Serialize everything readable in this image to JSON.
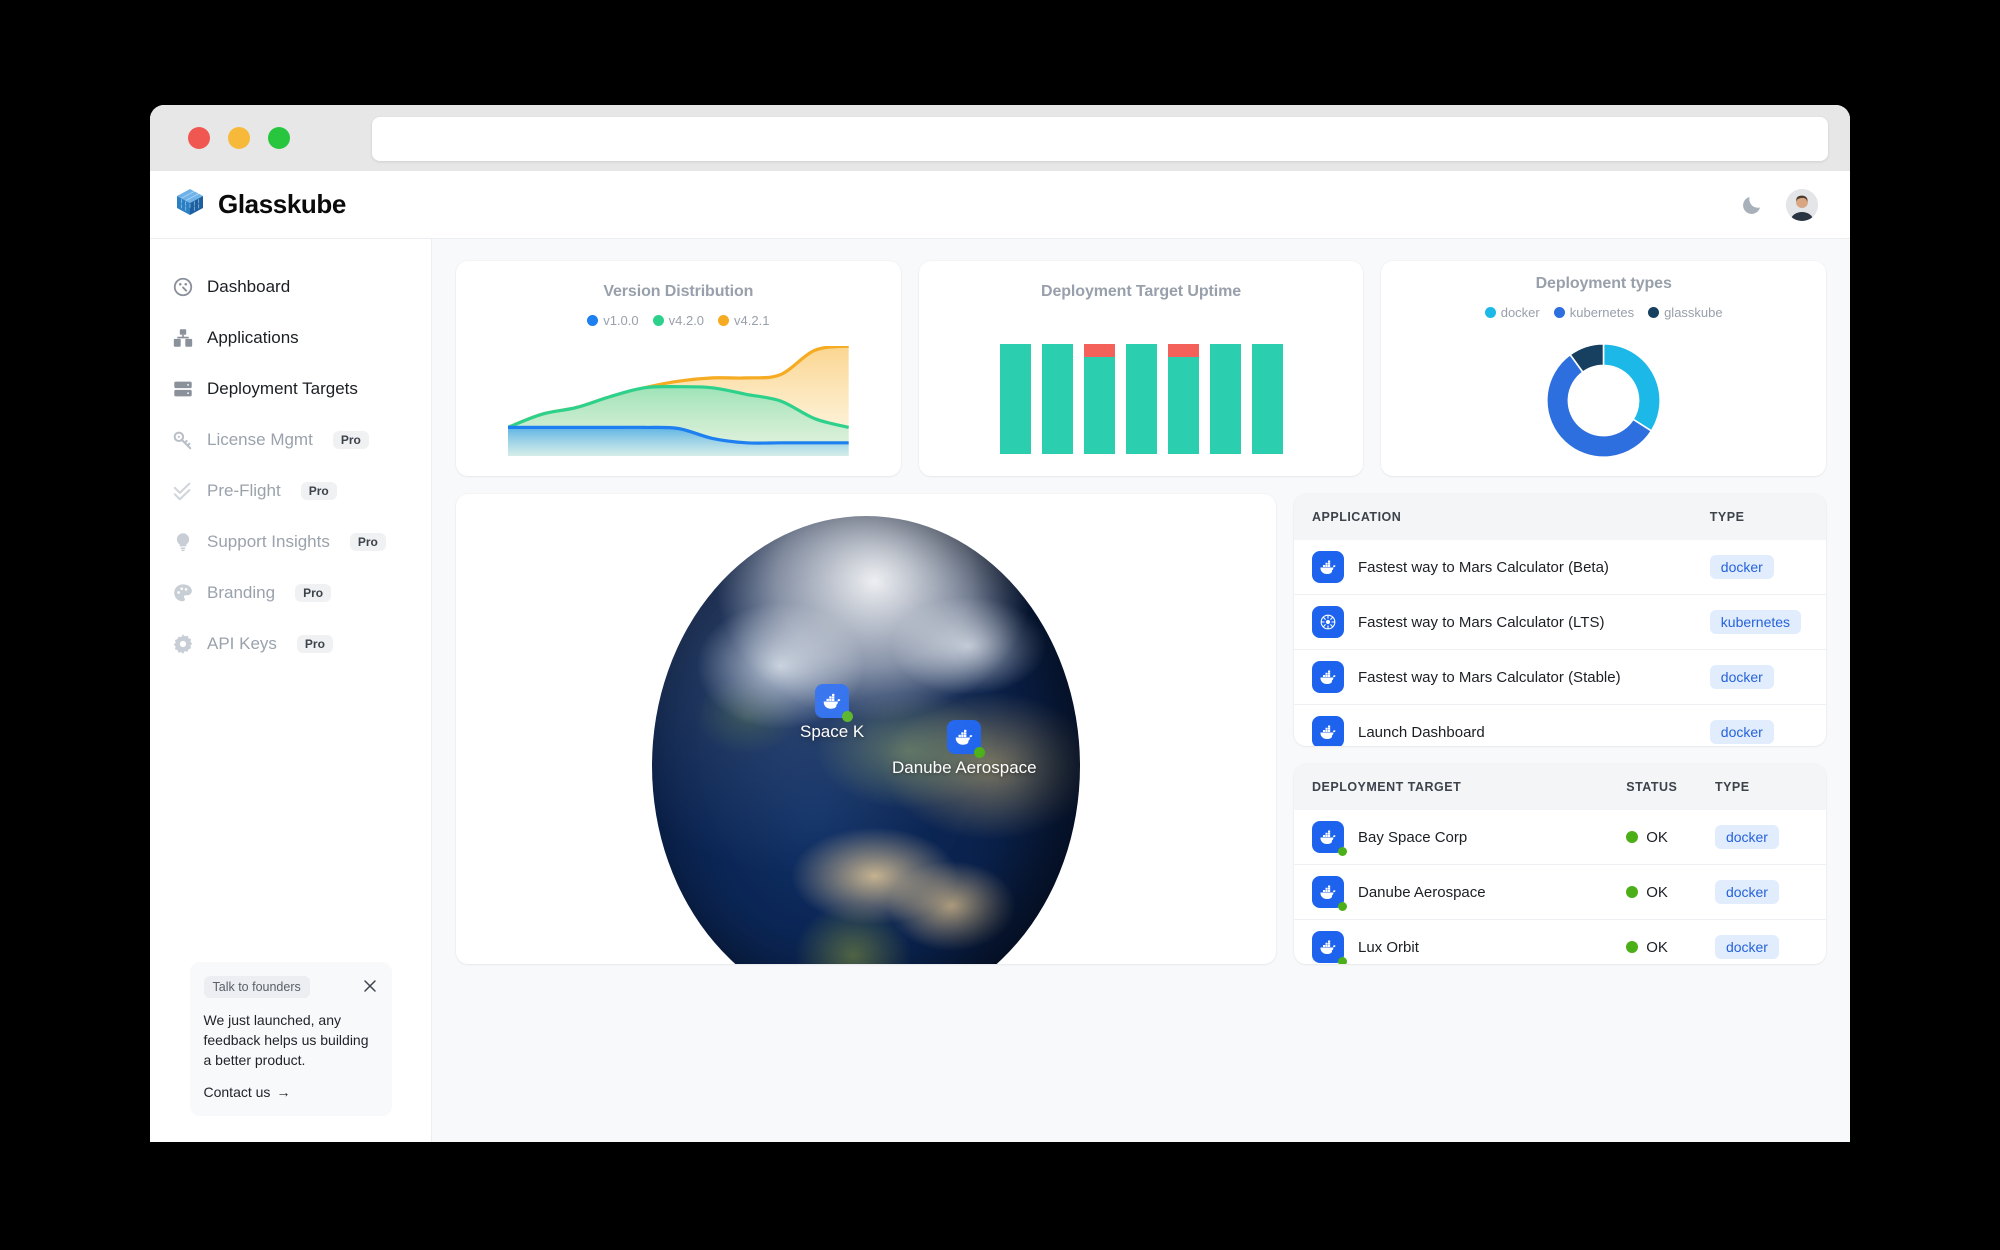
{
  "browser": {
    "url_value": "",
    "url_placeholder": "",
    "traffic_lights": [
      "close",
      "minimize",
      "maximize"
    ]
  },
  "header": {
    "brand": "Glasskube",
    "logo_icon": "glasskube-cube-icon",
    "theme_toggle_icon": "moon-icon",
    "avatar_icon": "user-avatar"
  },
  "sidebar": {
    "items": [
      {
        "label": "Dashboard",
        "icon": "gauge-icon",
        "pro": "",
        "muted": false
      },
      {
        "label": "Applications",
        "icon": "boxes-icon",
        "pro": "",
        "muted": false
      },
      {
        "label": "Deployment Targets",
        "icon": "server-icon",
        "pro": "",
        "muted": false
      },
      {
        "label": "License Mgmt",
        "icon": "key-icon",
        "pro": "Pro",
        "muted": true
      },
      {
        "label": "Pre-Flight",
        "icon": "double-check-icon",
        "pro": "Pro",
        "muted": true
      },
      {
        "label": "Support Insights",
        "icon": "lightbulb-icon",
        "pro": "Pro",
        "muted": true
      },
      {
        "label": "Branding",
        "icon": "palette-icon",
        "pro": "Pro",
        "muted": true
      },
      {
        "label": "API Keys",
        "icon": "gear-icon",
        "pro": "Pro",
        "muted": true
      }
    ],
    "founders_card": {
      "tag": "Talk to founders",
      "close_icon": "close-icon",
      "body": "We just launched, any feedback helps us building a better product.",
      "link": "Contact us",
      "link_arrow": "→"
    }
  },
  "chart_data": [
    {
      "type": "area",
      "title": "Version Distribution",
      "xlabel": "",
      "ylabel": "",
      "legend": [
        "v1.0.0",
        "v4.2.0",
        "v4.2.1"
      ],
      "legend_position": "top-center",
      "grid": false,
      "colors": {
        "v1.0.0": "#1d7ff0",
        "v4.2.0": "#2ed18c",
        "v4.2.1": "#f5ab22"
      },
      "x": [
        0,
        1,
        2,
        3,
        4,
        5,
        6,
        7,
        8,
        9,
        10
      ],
      "series": [
        {
          "name": "v1.0.0",
          "values": [
            26,
            26,
            26,
            26,
            26,
            25,
            16,
            12,
            12,
            12,
            12
          ]
        },
        {
          "name": "v4.2.0",
          "values": [
            26,
            38,
            44,
            54,
            62,
            63,
            62,
            56,
            50,
            34,
            26
          ]
        },
        {
          "name": "v4.2.1",
          "values": [
            26,
            38,
            44,
            54,
            62,
            68,
            71,
            71,
            74,
            96,
            100
          ]
        }
      ],
      "ylim": [
        0,
        100
      ]
    },
    {
      "type": "bar",
      "title": "Deployment Target Uptime",
      "xlabel": "",
      "ylabel": "",
      "grid": false,
      "stacked": true,
      "colors": {
        "up": "#2bcfb0",
        "down": "#f4615b"
      },
      "categories": [
        "1",
        "2",
        "3",
        "4",
        "5",
        "6",
        "7"
      ],
      "series": [
        {
          "name": "up",
          "values": [
            100,
            100,
            88,
            100,
            88,
            100,
            100
          ]
        },
        {
          "name": "down",
          "values": [
            0,
            0,
            12,
            0,
            12,
            0,
            0
          ]
        }
      ],
      "ylim": [
        0,
        100
      ]
    },
    {
      "type": "pie",
      "title": "Deployment types",
      "legend": [
        "docker",
        "kubernetes",
        "glasskube"
      ],
      "legend_position": "top-center",
      "donut": true,
      "labels": [
        "docker",
        "kubernetes",
        "glasskube"
      ],
      "values": [
        34,
        56,
        10
      ],
      "colors": [
        "#1cb8e8",
        "#2e6fe0",
        "#173f5f"
      ]
    }
  ],
  "globe": {
    "pins": [
      {
        "label": "Space K",
        "icon": "docker-icon",
        "status_icon": "green-status-dot"
      },
      {
        "label": "Danube Aerospace",
        "icon": "docker-icon",
        "status_icon": "green-status-dot"
      }
    ]
  },
  "applications_table": {
    "columns": [
      "APPLICATION",
      "TYPE"
    ],
    "rows": [
      {
        "name": "Fastest way to Mars Calculator (Beta)",
        "icon": "docker-icon",
        "type": "docker"
      },
      {
        "name": "Fastest way to Mars Calculator (LTS)",
        "icon": "kubernetes-icon",
        "type": "kubernetes"
      },
      {
        "name": "Fastest way to Mars Calculator (Stable)",
        "icon": "docker-icon",
        "type": "docker"
      },
      {
        "name": "Launch Dashboard",
        "icon": "docker-icon",
        "type": "docker"
      }
    ]
  },
  "deployment_targets_table": {
    "columns": [
      "DEPLOYMENT TARGET",
      "STATUS",
      "TYPE"
    ],
    "rows": [
      {
        "name": "Bay Space Corp",
        "icon": "docker-icon",
        "status": "OK",
        "type": "docker"
      },
      {
        "name": "Danube Aerospace",
        "icon": "docker-icon",
        "status": "OK",
        "type": "docker"
      },
      {
        "name": "Lux Orbit",
        "icon": "docker-icon",
        "status": "OK",
        "type": "docker"
      }
    ]
  },
  "colors": {
    "accent_blue": "#1d63ed",
    "badge_bg": "#e1ecfd",
    "badge_text": "#2563d9",
    "status_green": "#4caf18",
    "teal": "#2bcfb0",
    "red": "#f4615b",
    "page_bg": "#f8f9fb"
  }
}
